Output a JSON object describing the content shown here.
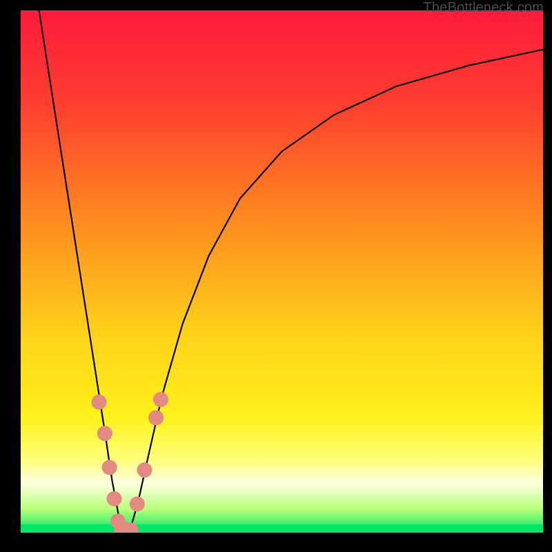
{
  "watermark": "TheBottleneck.com",
  "chart_data": {
    "type": "line",
    "title": "",
    "xlabel": "",
    "ylabel": "",
    "xlim": [
      0,
      100
    ],
    "ylim": [
      0,
      100
    ],
    "grid": false,
    "legend": false,
    "background_gradient_stops": [
      {
        "offset": 0,
        "color": "#ff1a3c"
      },
      {
        "offset": 0.18,
        "color": "#ff3e2f"
      },
      {
        "offset": 0.4,
        "color": "#ff8a1f"
      },
      {
        "offset": 0.62,
        "color": "#ffd21a"
      },
      {
        "offset": 0.78,
        "color": "#fff11a"
      },
      {
        "offset": 0.86,
        "color": "#fdff7a"
      },
      {
        "offset": 0.905,
        "color": "#ffffe0"
      },
      {
        "offset": 0.955,
        "color": "#b7ff7a"
      },
      {
        "offset": 1,
        "color": "#00e765"
      }
    ],
    "series": [
      {
        "name": "left-arm",
        "color": "#000000",
        "x": [
          3.5,
          6,
          8.5,
          11,
          13.5,
          16,
          17.5,
          18.7,
          19.3
        ],
        "y": [
          100,
          84,
          68,
          52,
          36,
          20,
          10,
          3.5,
          0
        ]
      },
      {
        "name": "right-arm",
        "color": "#000000",
        "x": [
          20.8,
          22.5,
          24.5,
          27,
          31,
          36,
          42,
          50,
          60,
          72,
          86,
          100
        ],
        "y": [
          0,
          6,
          15,
          26,
          40,
          53,
          64,
          73,
          80,
          85.5,
          89.5,
          92.5
        ]
      }
    ],
    "markers": [
      {
        "name": "scatter-dots",
        "color": "#e38b82",
        "radius": 11,
        "points": [
          {
            "x": 15.0,
            "y": 25.0
          },
          {
            "x": 16.1,
            "y": 19.0
          },
          {
            "x": 17.0,
            "y": 12.5
          },
          {
            "x": 17.9,
            "y": 6.5
          },
          {
            "x": 18.6,
            "y": 2.2
          },
          {
            "x": 19.3,
            "y": 0.5
          },
          {
            "x": 20.3,
            "y": 0.5
          },
          {
            "x": 21.1,
            "y": 0.5
          },
          {
            "x": 22.3,
            "y": 5.5
          },
          {
            "x": 23.7,
            "y": 12.0
          },
          {
            "x": 25.9,
            "y": 22.0
          },
          {
            "x": 26.8,
            "y": 25.5
          }
        ]
      }
    ],
    "baseline_band": {
      "color": "#00e765",
      "y0": 0,
      "y1": 1.6
    }
  }
}
